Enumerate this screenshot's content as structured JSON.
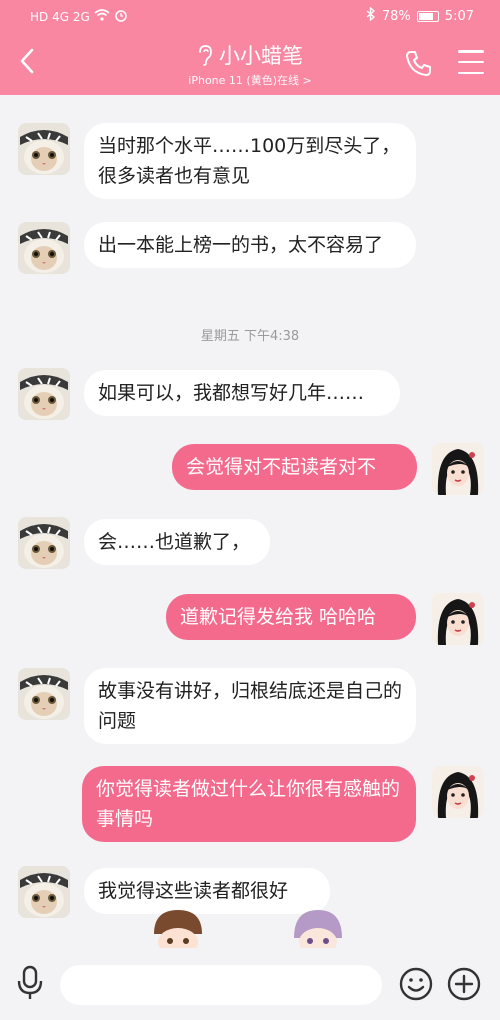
{
  "status_bar": {
    "network_left": "HD 4G 2G",
    "battery": "78%",
    "time": "5:07"
  },
  "header": {
    "title": "小小蜡笔",
    "subtitle": "iPhone 11 (黄色)在线 >",
    "accent_color": "#f987a2"
  },
  "messages": [
    {
      "side": "in",
      "text": "当时那个水平……100万到尽头了，很多读者也有意见"
    },
    {
      "side": "in",
      "text": "出一本能上榜一的书，太不容易了"
    },
    {
      "side": "in",
      "text": "如果可以，我都想写好几年……"
    },
    {
      "side": "out",
      "text": "会觉得对不起读者对不"
    },
    {
      "side": "in",
      "text": "会……也道歉了，"
    },
    {
      "side": "out",
      "text": "道歉记得发给我 哈哈哈"
    },
    {
      "side": "in",
      "text": "故事没有讲好，归根结底还是自己的问题"
    },
    {
      "side": "out",
      "text": "你觉得读者做过什么让你很有感触的事情吗"
    },
    {
      "side": "in",
      "text": "我觉得这些读者都很好"
    }
  ],
  "timestamp": "星期五 下午4:38",
  "icons": {
    "back": "back-arrow-icon",
    "phone": "phone-icon",
    "menu": "menu-icon",
    "mic": "mic-icon",
    "emoji": "emoji-icon",
    "plus": "plus-icon"
  }
}
